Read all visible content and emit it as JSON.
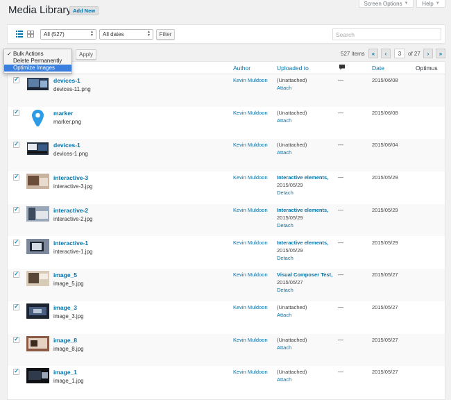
{
  "header": {
    "screen_options": "Screen Options",
    "help": "Help",
    "title": "Media Library",
    "add_new": "Add New"
  },
  "filters": {
    "type_select": "All (527)",
    "date_select": "All dates",
    "filter_button": "Filter",
    "search_placeholder": "Search"
  },
  "bulk": {
    "options": [
      "Bulk Actions",
      "Delete Permanently",
      "Optimize Images"
    ],
    "selected": "Optimize Images",
    "apply": "Apply"
  },
  "pagination": {
    "items": "527 items",
    "first": "«",
    "prev": "‹",
    "current": "3",
    "of": "of 27",
    "next": "›",
    "last": "»"
  },
  "columns": {
    "author": "Author",
    "uploaded_to": "Uploaded to",
    "comments_icon": "comment-bubble-icon",
    "date": "Date",
    "optimus": "Optimus"
  },
  "rows": [
    {
      "title": "devices-1",
      "file": "devices-11.png",
      "author": "Kevin Muldoon",
      "up1": "(Unattached)",
      "up2": "",
      "action": "Attach",
      "comments": "—",
      "date": "2015/06/08"
    },
    {
      "title": "marker",
      "file": "marker.png",
      "author": "Kevin Muldoon",
      "up1": "(Unattached)",
      "up2": "",
      "action": "Attach",
      "comments": "—",
      "date": "2015/06/08"
    },
    {
      "title": "devices-1",
      "file": "devices-1.png",
      "author": "Kevin Muldoon",
      "up1": "(Unattached)",
      "up2": "",
      "action": "Attach",
      "comments": "—",
      "date": "2015/06/04"
    },
    {
      "title": "interactive-3",
      "file": "interactive-3.jpg",
      "author": "Kevin Muldoon",
      "up1": "Interactive elements,",
      "up2": "2015/05/29",
      "action": "Detach",
      "comments": "—",
      "date": "2015/05/29"
    },
    {
      "title": "interactive-2",
      "file": "interactive-2.jpg",
      "author": "Kevin Muldoon",
      "up1": "Interactive elements,",
      "up2": "2015/05/29",
      "action": "Detach",
      "comments": "—",
      "date": "2015/05/29"
    },
    {
      "title": "interactive-1",
      "file": "interactive-1.jpg",
      "author": "Kevin Muldoon",
      "up1": "Interactive elements,",
      "up2": "2015/05/29",
      "action": "Detach",
      "comments": "—",
      "date": "2015/05/29"
    },
    {
      "title": "image_5",
      "file": "image_5.jpg",
      "author": "Kevin Muldoon",
      "up1": "Visual Composer Test,",
      "up2": "2015/05/27",
      "action": "Detach",
      "comments": "—",
      "date": "2015/05/27"
    },
    {
      "title": "image_3",
      "file": "image_3.jpg",
      "author": "Kevin Muldoon",
      "up1": "(Unattached)",
      "up2": "",
      "action": "Attach",
      "comments": "—",
      "date": "2015/05/27"
    },
    {
      "title": "image_8",
      "file": "image_8.jpg",
      "author": "Kevin Muldoon",
      "up1": "(Unattached)",
      "up2": "",
      "action": "Attach",
      "comments": "—",
      "date": "2015/05/27"
    },
    {
      "title": "image_1",
      "file": "image_1.jpg",
      "author": "Kevin Muldoon",
      "up1": "(Unattached)",
      "up2": "",
      "action": "Attach",
      "comments": "—",
      "date": "2015/05/27"
    }
  ]
}
